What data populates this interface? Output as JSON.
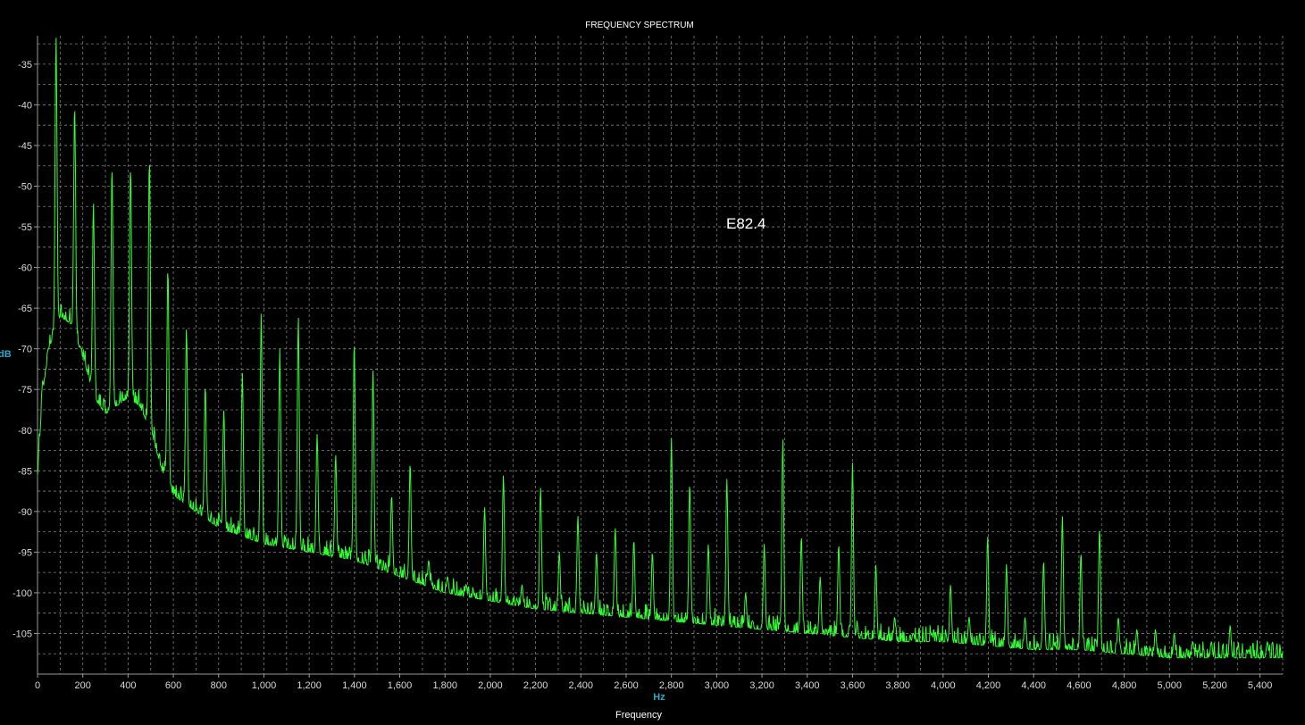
{
  "title": "FREQUENCY SPECTRUM",
  "annotation": "E82.4",
  "colors": {
    "background": "#000000",
    "grid": "#7c7c7c",
    "trace": "#33ff33",
    "unit_label": "#2aa9c9"
  },
  "chart_data": {
    "type": "line",
    "title": "FREQUENCY SPECTRUM",
    "xlabel": "Frequency",
    "xunit": "Hz",
    "yunit": "dB",
    "xlim": [
      0,
      5500
    ],
    "ylim": [
      -110,
      -31.5
    ],
    "grid": true,
    "x_ticks": [
      0,
      200,
      400,
      600,
      800,
      1000,
      1200,
      1400,
      1600,
      1800,
      2000,
      2200,
      2400,
      2600,
      2800,
      3000,
      3200,
      3400,
      3600,
      3800,
      4000,
      4200,
      4400,
      4600,
      4800,
      5000,
      5200,
      5400
    ],
    "x_tick_labels": [
      "0",
      "200",
      "400",
      "600",
      "800",
      "1,000",
      "1,200",
      "1,400",
      "1,600",
      "1,800",
      "2,000",
      "2,200",
      "2,400",
      "2,600",
      "2,800",
      "3,000",
      "3,200",
      "3,400",
      "3,600",
      "3,800",
      "4,000",
      "4,200",
      "4,400",
      "4,600",
      "4,800",
      "5,000",
      "5,200",
      "5,400"
    ],
    "y_ticks": [
      -35,
      -40,
      -45,
      -50,
      -55,
      -60,
      -65,
      -70,
      -75,
      -80,
      -85,
      -90,
      -95,
      -100,
      -105
    ],
    "y_tick_labels": [
      "-35",
      "-40",
      "-45",
      "-50",
      "-55",
      "-60",
      "-65",
      "-70",
      "-75",
      "-80",
      "-85",
      "-90",
      "-95",
      "-100",
      "-105"
    ],
    "baseline": [
      [
        0,
        -86
      ],
      [
        20,
        -76
      ],
      [
        50,
        -70
      ],
      [
        100,
        -66
      ],
      [
        150,
        -67
      ],
      [
        200,
        -71
      ],
      [
        250,
        -76
      ],
      [
        300,
        -78
      ],
      [
        350,
        -77
      ],
      [
        400,
        -76
      ],
      [
        450,
        -77
      ],
      [
        500,
        -80
      ],
      [
        550,
        -85
      ],
      [
        600,
        -88
      ],
      [
        700,
        -90
      ],
      [
        800,
        -92
      ],
      [
        900,
        -93
      ],
      [
        1000,
        -94
      ],
      [
        1200,
        -95
      ],
      [
        1400,
        -96
      ],
      [
        1600,
        -98
      ],
      [
        1800,
        -100
      ],
      [
        2000,
        -101
      ],
      [
        2200,
        -102
      ],
      [
        2400,
        -102.5
      ],
      [
        2600,
        -103
      ],
      [
        2800,
        -103.5
      ],
      [
        3000,
        -104
      ],
      [
        3200,
        -104.5
      ],
      [
        3400,
        -105
      ],
      [
        3600,
        -105.5
      ],
      [
        3800,
        -106
      ],
      [
        4000,
        -106
      ],
      [
        4200,
        -106.5
      ],
      [
        4400,
        -107
      ],
      [
        4600,
        -107
      ],
      [
        4800,
        -107.5
      ],
      [
        5000,
        -108
      ],
      [
        5200,
        -108
      ],
      [
        5400,
        -108
      ],
      [
        5500,
        -108
      ]
    ],
    "peaks": [
      {
        "f": 82,
        "db": -31.5
      },
      {
        "f": 164,
        "db": -40
      },
      {
        "f": 247,
        "db": -52
      },
      {
        "f": 329,
        "db": -47.5
      },
      {
        "f": 411,
        "db": -47.5
      },
      {
        "f": 494,
        "db": -46.5
      },
      {
        "f": 576,
        "db": -60
      },
      {
        "f": 658,
        "db": -67.5
      },
      {
        "f": 741,
        "db": -74.5
      },
      {
        "f": 823,
        "db": -77.5
      },
      {
        "f": 905,
        "db": -73
      },
      {
        "f": 988,
        "db": -65.5
      },
      {
        "f": 1070,
        "db": -70
      },
      {
        "f": 1152,
        "db": -66
      },
      {
        "f": 1235,
        "db": -80.5
      },
      {
        "f": 1317,
        "db": -83
      },
      {
        "f": 1399,
        "db": -69
      },
      {
        "f": 1482,
        "db": -72.5
      },
      {
        "f": 1564,
        "db": -88
      },
      {
        "f": 1646,
        "db": -84
      },
      {
        "f": 1728,
        "db": -96
      },
      {
        "f": 1811,
        "db": -98
      },
      {
        "f": 1893,
        "db": -99
      },
      {
        "f": 1975,
        "db": -89.5
      },
      {
        "f": 2058,
        "db": -85.5
      },
      {
        "f": 2140,
        "db": -99
      },
      {
        "f": 2222,
        "db": -87
      },
      {
        "f": 2305,
        "db": -95
      },
      {
        "f": 2387,
        "db": -90.5
      },
      {
        "f": 2469,
        "db": -95
      },
      {
        "f": 2552,
        "db": -92
      },
      {
        "f": 2634,
        "db": -93.5
      },
      {
        "f": 2716,
        "db": -95
      },
      {
        "f": 2800,
        "db": -81
      },
      {
        "f": 2881,
        "db": -86.5
      },
      {
        "f": 2963,
        "db": -94
      },
      {
        "f": 3045,
        "db": -86
      },
      {
        "f": 3128,
        "db": -100
      },
      {
        "f": 3210,
        "db": -94
      },
      {
        "f": 3292,
        "db": -81
      },
      {
        "f": 3374,
        "db": -93
      },
      {
        "f": 3457,
        "db": -98
      },
      {
        "f": 3539,
        "db": -94
      },
      {
        "f": 3600,
        "db": -84
      },
      {
        "f": 3703,
        "db": -96.5
      },
      {
        "f": 3786,
        "db": -103
      },
      {
        "f": 3868,
        "db": -105
      },
      {
        "f": 3950,
        "db": -105
      },
      {
        "f": 4033,
        "db": -99
      },
      {
        "f": 4115,
        "db": -103
      },
      {
        "f": 4197,
        "db": -93
      },
      {
        "f": 4280,
        "db": -96.5
      },
      {
        "f": 4362,
        "db": -103
      },
      {
        "f": 4444,
        "db": -96
      },
      {
        "f": 4527,
        "db": -90.5
      },
      {
        "f": 4609,
        "db": -95
      },
      {
        "f": 4691,
        "db": -92
      },
      {
        "f": 4774,
        "db": -103
      },
      {
        "f": 4856,
        "db": -104.5
      },
      {
        "f": 4938,
        "db": -104.5
      },
      {
        "f": 5021,
        "db": -105
      },
      {
        "f": 5103,
        "db": -106
      },
      {
        "f": 5185,
        "db": -106
      },
      {
        "f": 5268,
        "db": -104
      },
      {
        "f": 5350,
        "db": -107
      },
      {
        "f": 5432,
        "db": -106
      }
    ]
  }
}
